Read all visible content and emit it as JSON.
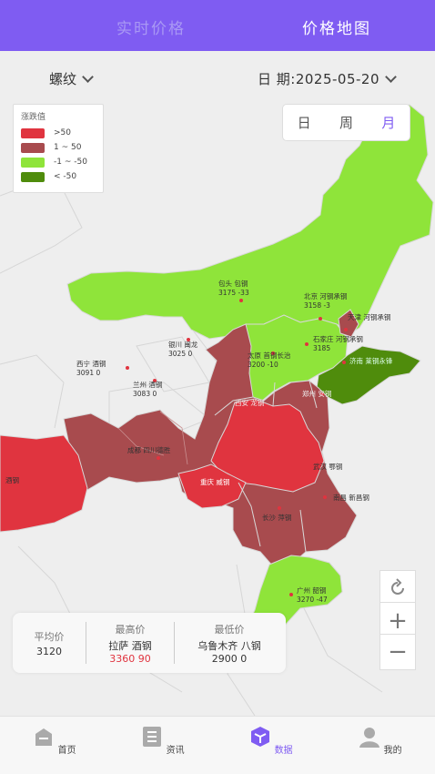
{
  "header": {
    "tab_realtime": "实时价格",
    "tab_map": "价格地图"
  },
  "filters": {
    "product": "螺纹",
    "date_label": "日 期:2025-05-20"
  },
  "legend": {
    "title": "涨跌值",
    "items": [
      {
        "label": ">50",
        "color": "#e0343f"
      },
      {
        "label": "1 ~ 50",
        "color": "#a84b4e"
      },
      {
        "label": "-1 ~ -50",
        "color": "#8fe43a"
      },
      {
        "label": "< -50",
        "color": "#4f8c0c"
      }
    ]
  },
  "period": {
    "day": "日",
    "week": "周",
    "month": "月",
    "selected": "月"
  },
  "cities": [
    {
      "name": "包头 包钢",
      "value": "3175 -33"
    },
    {
      "name": "北京 河钢承钢",
      "value": "3158 -3"
    },
    {
      "name": "天津 河钢承钢",
      "value": ""
    },
    {
      "name": "银川 闽龙",
      "value": "3025 0"
    },
    {
      "name": "石家庄 河钢承钢",
      "value": "3185"
    },
    {
      "name": "太原 首钢长治",
      "value": "3200 -10"
    },
    {
      "name": "济南 莱钢永锋",
      "value": ""
    },
    {
      "name": "西宁 酒钢",
      "value": "3091 0"
    },
    {
      "name": "兰州 酒钢",
      "value": "3083 0"
    },
    {
      "name": "西安 龙钢",
      "value": ""
    },
    {
      "name": "郑州 安钢",
      "value": ""
    },
    {
      "name": "成都 四川德胜",
      "value": ""
    },
    {
      "name": "重庆 威钢",
      "value": ""
    },
    {
      "name": "武汉 鄂钢",
      "value": ""
    },
    {
      "name": "长沙 萍钢",
      "value": ""
    },
    {
      "name": "南昌 新昌钢",
      "value": ""
    },
    {
      "name": "广州 韶钢",
      "value": "3270 -47"
    },
    {
      "name": "酒钢",
      "value": ""
    }
  ],
  "stats": {
    "avg_label": "平均价",
    "avg_value": "3120",
    "max_label": "最高价",
    "max_city": "拉萨 酒钢",
    "max_value": "3360 90",
    "min_label": "最低价",
    "min_city": "乌鲁木齐 八钢",
    "min_value": "2900 0"
  },
  "colors": {
    "accent": "#7f5cf2",
    "up_high": "#e0343f",
    "up_low": "#a84b4e",
    "down_low": "#8fe43a",
    "down_high": "#4f8c0c"
  },
  "map_controls": [
    "refresh-icon",
    "zoom-in-icon",
    "zoom-out-icon"
  ],
  "nav": {
    "home": "首页",
    "news": "资讯",
    "data": "数据",
    "me": "我的"
  }
}
